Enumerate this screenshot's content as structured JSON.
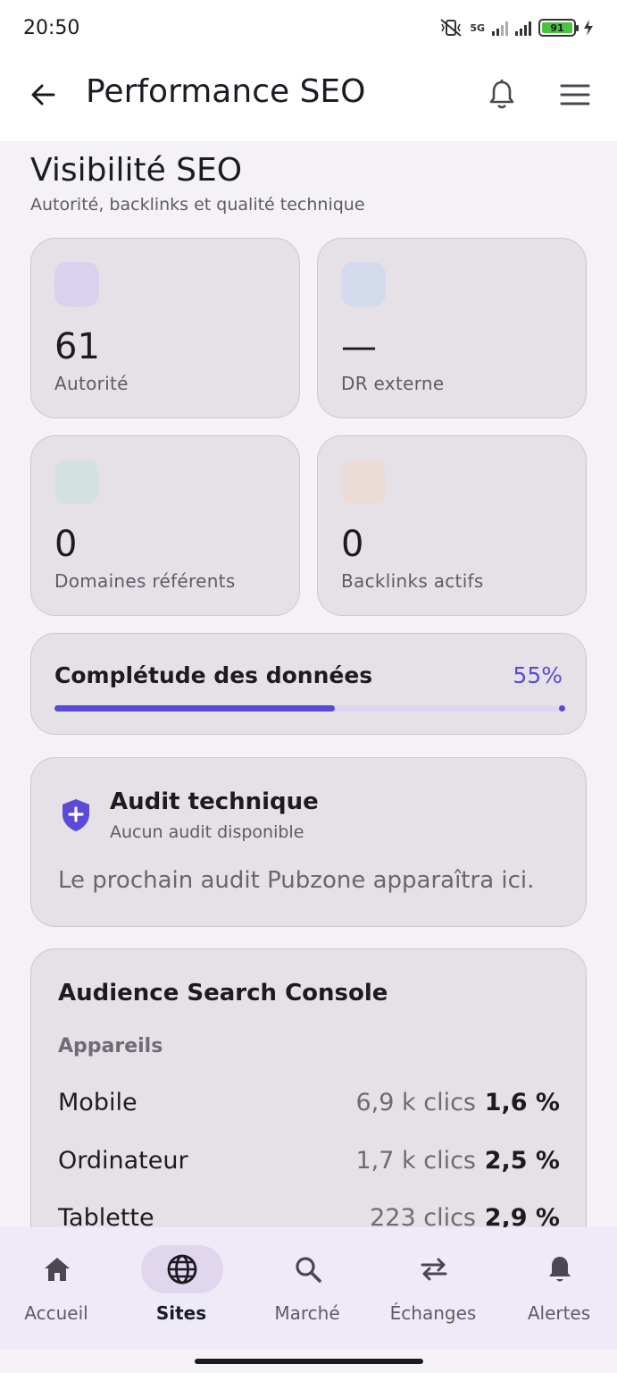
{
  "status_bar": {
    "time": "20:50",
    "network": "5G",
    "battery": "91"
  },
  "app_bar": {
    "title": "Performance SEO"
  },
  "section": {
    "title": "Visibilité SEO",
    "subtitle": "Autorité, backlinks et qualité technique"
  },
  "stats": [
    {
      "value": "61",
      "label": "Autorité",
      "icon_color": "#d9d1ee"
    },
    {
      "value": "—",
      "label": "DR externe",
      "icon_color": "#d3daec"
    },
    {
      "value": "0",
      "label": "Domaines référents",
      "icon_color": "#d4e2df"
    },
    {
      "value": "0",
      "label": "Backlinks actifs",
      "icon_color": "#ecdcd7"
    }
  ],
  "completeness": {
    "label": "Complétude des données",
    "percent_text": "55%",
    "fraction": 0.55
  },
  "audit": {
    "title": "Audit technique",
    "subtitle": "Aucun audit disponible",
    "note": "Le prochain audit Pubzone apparaîtra ici."
  },
  "audience": {
    "title": "Audience Search Console",
    "subtitle": "Appareils",
    "rows": [
      {
        "name": "Mobile",
        "clicks": "6,9 k clics",
        "pct": "1,6 %"
      },
      {
        "name": "Ordinateur",
        "clicks": "1,7 k clics",
        "pct": "2,5 %"
      },
      {
        "name": "Tablette",
        "clicks": "223 clics",
        "pct": "2,9 %"
      }
    ]
  },
  "nav": [
    {
      "label": "Accueil",
      "icon": "home-icon",
      "active": false
    },
    {
      "label": "Sites",
      "icon": "globe-icon",
      "active": true
    },
    {
      "label": "Marché",
      "icon": "search-icon",
      "active": false
    },
    {
      "label": "Échanges",
      "icon": "swap-icon",
      "active": false
    },
    {
      "label": "Alertes",
      "icon": "bell-icon",
      "active": false
    }
  ],
  "colors": {
    "accent": "#5a4bd6",
    "card": "#e6e1e7",
    "background": "#f4f2f7"
  }
}
